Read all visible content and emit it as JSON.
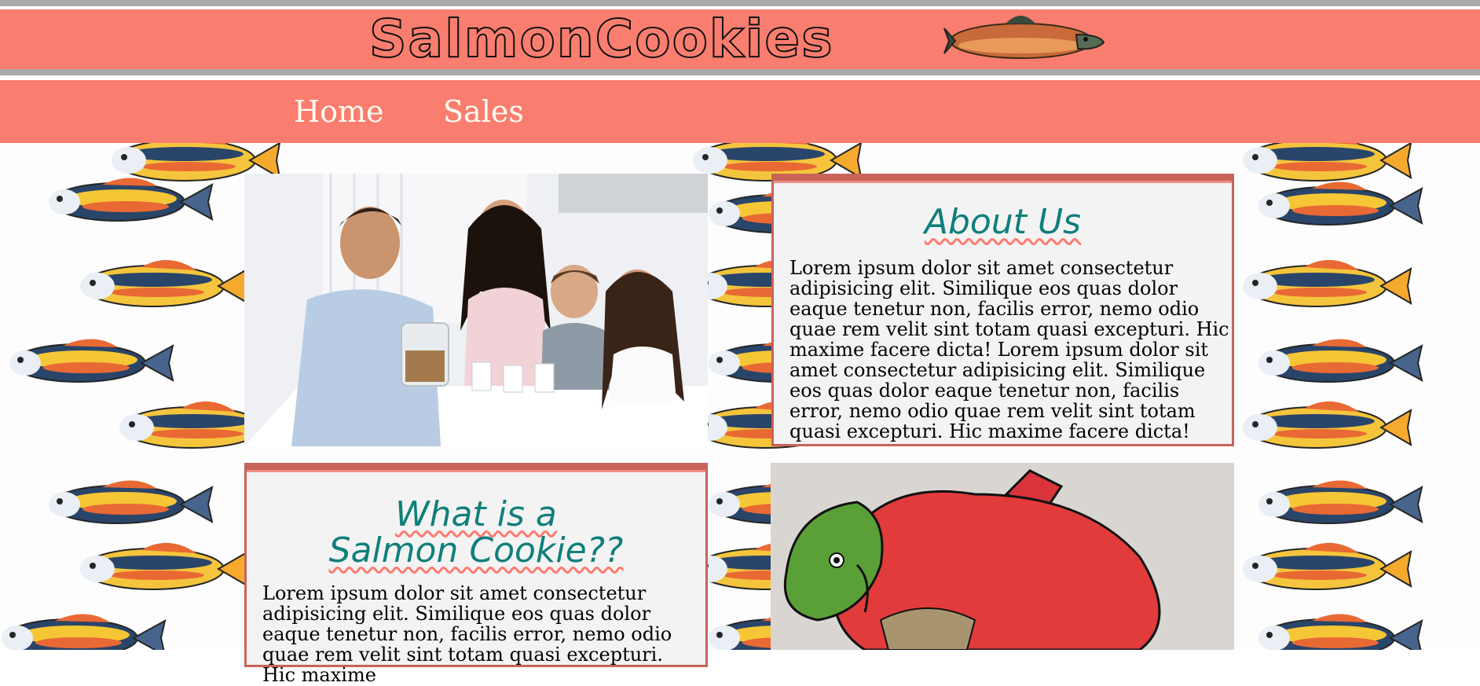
{
  "header": {
    "logo_text": "SalmonCookies"
  },
  "nav": {
    "items": [
      {
        "label": "Home"
      },
      {
        "label": "Sales"
      }
    ]
  },
  "about": {
    "heading": "About Us",
    "body": "Lorem ipsum dolor sit amet consectetur adipisicing elit. Similique eos quas dolor eaque tenetur non, facilis error, nemo odio quae rem velit sint totam quasi excepturi. Hic maxime facere dicta! Lorem ipsum dolor sit amet consectetur adipisicing elit. Similique eos quas dolor eaque tenetur non, facilis error, nemo odio quae rem velit sint totam quasi excepturi. Hic maxime facere dicta!"
  },
  "what": {
    "heading": "What is a Salmon Cookie??",
    "body": "Lorem ipsum dolor sit amet consectetur adipisicing elit. Similique eos quas dolor eaque tenetur non, facilis error, nemo odio quae rem velit sint totam quasi excepturi. Hic maxime"
  },
  "colors": {
    "banner": "#fa7e6f",
    "accent_border": "#c8635a",
    "heading": "#0f7f7a"
  }
}
